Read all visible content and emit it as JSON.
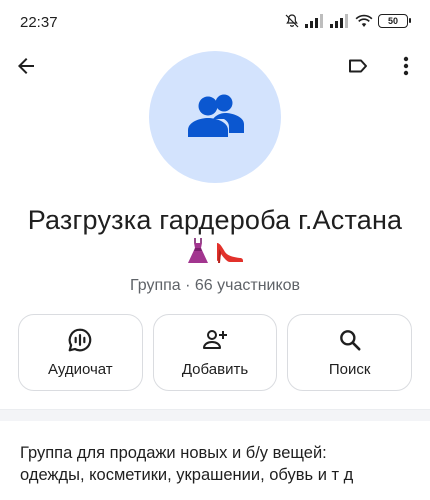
{
  "status_bar": {
    "time": "22:37",
    "battery": "50",
    "icons": [
      "mute-icon",
      "signal-icon",
      "signal-icon",
      "wifi-icon",
      "battery-icon"
    ]
  },
  "topbar": {
    "icons": [
      "arrow-back-icon",
      "label-icon",
      "more-vert-icon"
    ]
  },
  "avatar": {
    "icon": "group-icon",
    "background": "#d3e3fd",
    "icon_color": "#0b57d0"
  },
  "group": {
    "name": "Разгрузка гардероба г.Астана",
    "emoji": [
      "dress-emoji",
      "high-heel-emoji"
    ],
    "meta": "Группа · 66 участников"
  },
  "actions": [
    {
      "label": "Аудиочат",
      "icon": "audio-chat-icon"
    },
    {
      "label": "Добавить",
      "icon": "add-person-icon"
    },
    {
      "label": "Поиск",
      "icon": "search-icon"
    }
  ],
  "description": {
    "line1": "Группа для продажи новых и б/у вещей:",
    "line2": "одежды, косметики, украшении, обувь и т д"
  }
}
